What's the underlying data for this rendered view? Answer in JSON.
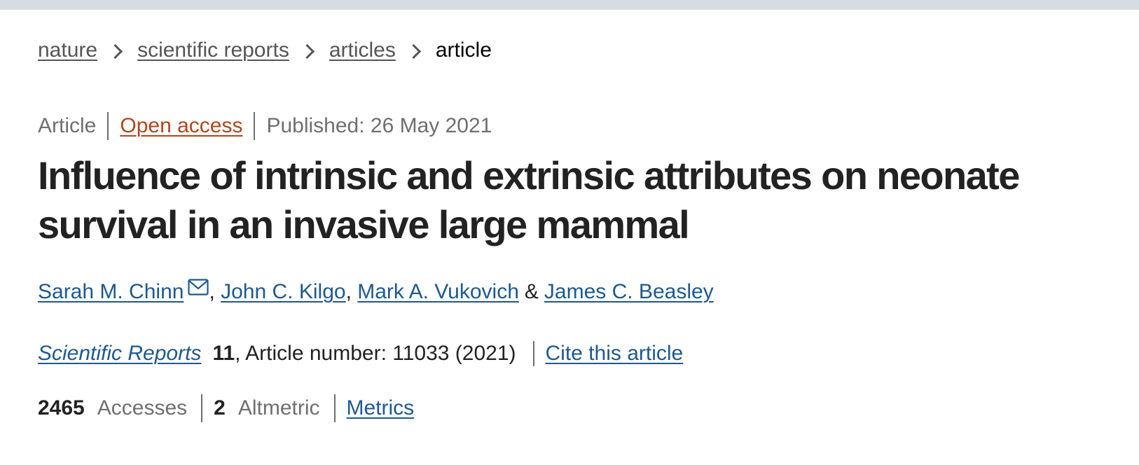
{
  "breadcrumb": {
    "items": [
      {
        "label": "nature"
      },
      {
        "label": "scientific reports"
      },
      {
        "label": "articles"
      }
    ],
    "current": "article"
  },
  "meta": {
    "type": "Article",
    "access": "Open access",
    "published": "Published: 26 May 2021"
  },
  "article": {
    "title": "Influence of intrinsic and extrinsic attributes on neonate survival in an invasive large mammal"
  },
  "authors": {
    "list": [
      {
        "name": "Sarah M. Chinn"
      },
      {
        "name": "John C. Kilgo"
      },
      {
        "name": "Mark A. Vukovich"
      },
      {
        "name": "James C. Beasley"
      }
    ],
    "comma": ",",
    "ampersand": "&"
  },
  "citation": {
    "journal": "Scientific Reports",
    "volume": "11",
    "details": ", Article number: 11033 (2021)",
    "cite_label": "Cite this article"
  },
  "metrics": {
    "accesses_count": "2465",
    "accesses_label": "Accesses",
    "altmetric_count": "2",
    "altmetric_label": "Altmetric",
    "metrics_link": "Metrics"
  },
  "colors": {
    "link": "#1e598f",
    "open_access": "#b1451c",
    "muted": "#6f6f6f",
    "top_bar": "#d5dde3"
  },
  "icons": {
    "corresponding_author": "mail-icon"
  }
}
